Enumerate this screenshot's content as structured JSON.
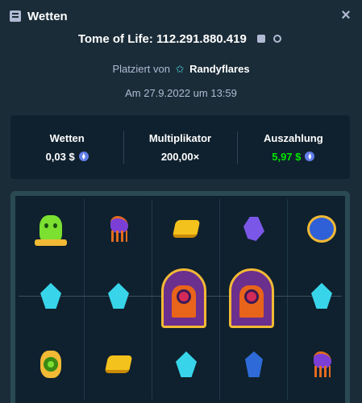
{
  "header": {
    "title": "Wetten",
    "icon": "bet-slip-icon",
    "close_icon": "close-icon"
  },
  "game": {
    "text": "Tome of Life: 112.291.880.419"
  },
  "placed": {
    "prefix": "Platziert von",
    "username": "Randyflares",
    "user_icon": "star-icon"
  },
  "date": "Am 27.9.2022 um 13:59",
  "stats": {
    "bet_label": "Wetten",
    "bet_value": "0,03 $",
    "multiplier_label": "Multiplikator",
    "multiplier_value": "200,00×",
    "payout_label": "Auszahlung",
    "payout_value": "5,97 $",
    "currency_icon": "ethereum-coin-icon",
    "payout_color": "#00e701"
  },
  "colors": {
    "background": "#1a2c38",
    "panel": "#0f212e",
    "muted_text": "#b1bad3"
  }
}
